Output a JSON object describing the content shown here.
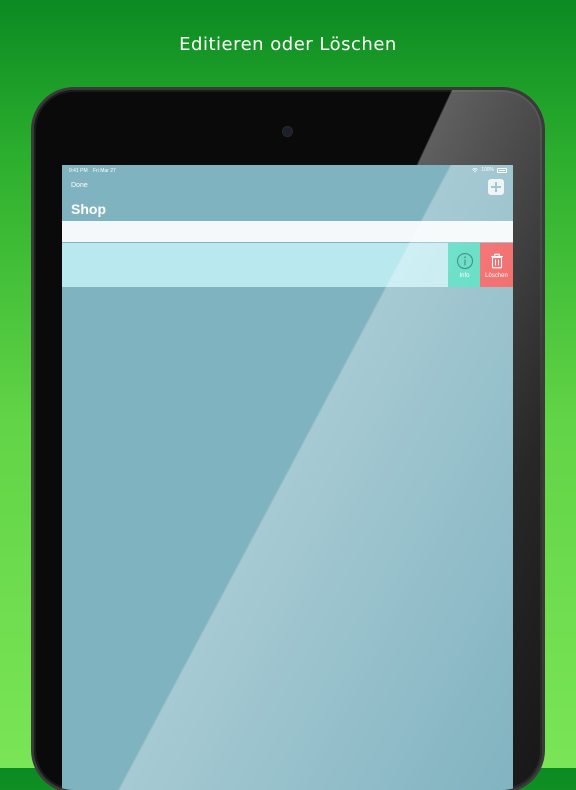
{
  "promo": {
    "headline": "Editieren oder Löschen"
  },
  "status_bar": {
    "time": "9:41 PM",
    "date": "Fri Mar 27",
    "battery": "100%"
  },
  "nav": {
    "done_label": "Done",
    "title": "Shop",
    "add_icon": "plus-icon"
  },
  "search": {
    "value": "",
    "placeholder": ""
  },
  "list": {
    "rows": [
      {
        "text": "",
        "actions": [
          {
            "label": "Info",
            "icon": "info-icon",
            "color": "#3cd6b8"
          },
          {
            "label": "Löschen",
            "icon": "trash-icon",
            "color": "#f04a4a"
          }
        ]
      }
    ]
  },
  "colors": {
    "background_green": "#2fb12f",
    "screen": "#80b3c0",
    "row": "#b9e8ee"
  }
}
